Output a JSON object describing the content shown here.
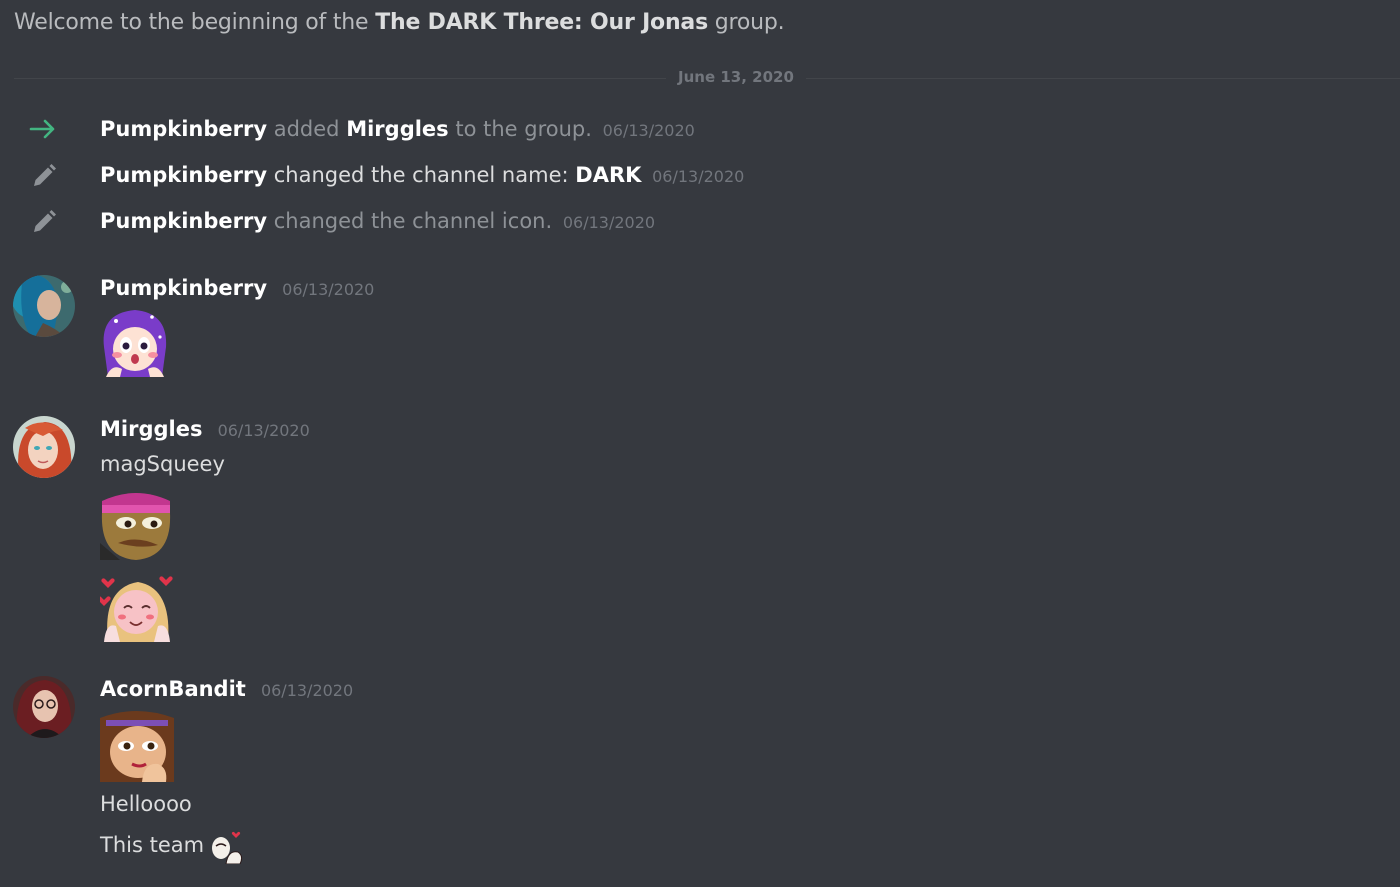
{
  "welcome": {
    "prefix": "Welcome to the beginning of the",
    "group_name": "The DARK Three: Our Jonas",
    "suffix": "group."
  },
  "date_divider": "June 13, 2020",
  "system_messages": [
    {
      "icon": "arrow-right-icon",
      "actor": "Pumpkinberry",
      "action": "added",
      "target": "Mirggles",
      "rest": "to the group.",
      "timestamp": "06/13/2020"
    },
    {
      "icon": "pencil-icon",
      "actor": "Pumpkinberry",
      "action": "changed the channel name:",
      "target": "DARK",
      "timestamp": "06/13/2020"
    },
    {
      "icon": "pencil-icon",
      "actor": "Pumpkinberry",
      "action": "changed the channel icon.",
      "timestamp": "06/13/2020"
    }
  ],
  "messages": [
    {
      "username": "Pumpkinberry",
      "timestamp": "06/13/2020",
      "content": [
        {
          "type": "emote",
          "name": "purple-hair-blush-emote"
        }
      ]
    },
    {
      "username": "Mirggles",
      "timestamp": "06/13/2020",
      "content": [
        {
          "type": "text",
          "text": "magSqueey"
        },
        {
          "type": "emote",
          "name": "frog-beanie-emote"
        },
        {
          "type": "emote",
          "name": "blonde-blush-hearts-emote"
        }
      ]
    },
    {
      "username": "AcornBandit",
      "timestamp": "06/13/2020",
      "content": [
        {
          "type": "emote",
          "name": "brown-hair-gasp-emote"
        },
        {
          "type": "text",
          "text": "Helloooo"
        },
        {
          "type": "text",
          "text": "This team",
          "inline_emote": "heart-hands-emote"
        }
      ]
    }
  ],
  "colors": {
    "background": "#36393f",
    "join_arrow": "#43b581",
    "muted_text": "#72767d",
    "username": "#ffffff"
  }
}
